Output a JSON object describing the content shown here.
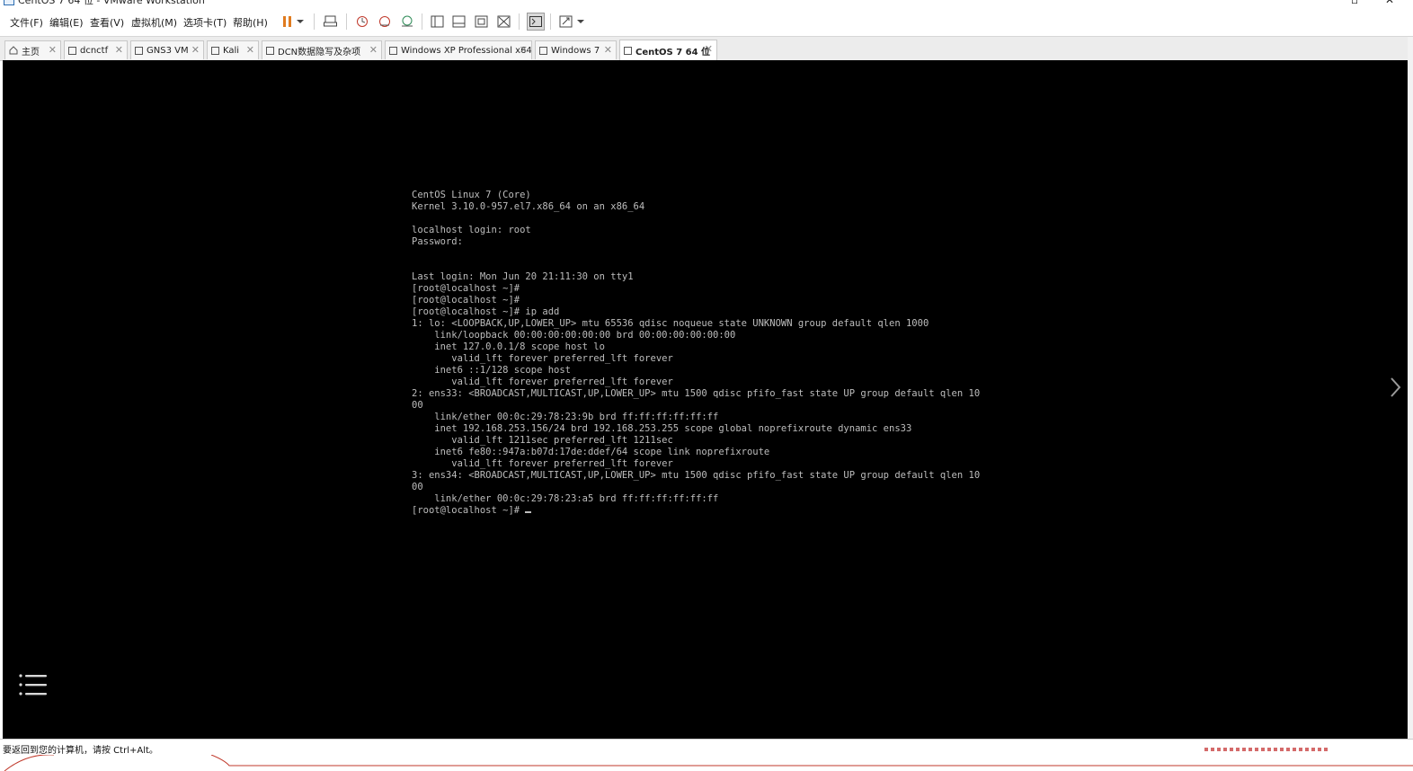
{
  "window": {
    "title": "CentOS 7 64 位 - VMware Workstation"
  },
  "menu": {
    "items": [
      "文件(F)",
      "编辑(E)",
      "查看(V)",
      "虚拟机(M)",
      "选项卡(T)",
      "帮助(H)"
    ]
  },
  "toolbar": {
    "icons": [
      "pause-icon",
      "dropdown-icon",
      "send-ctrl-alt-del-icon",
      "snapshot-icon",
      "revert-snapshot-icon",
      "snapshot-manager-icon",
      "show-library-icon",
      "thumbnail-bar-icon",
      "full-screen-icon",
      "unity-icon",
      "console-view-icon",
      "stretch-guest-icon"
    ]
  },
  "tabs": [
    {
      "label": "主页",
      "icon": "home-icon",
      "active": false
    },
    {
      "label": "dcnctf",
      "icon": "vm-icon",
      "active": false
    },
    {
      "label": "GNS3 VM",
      "icon": "vm-icon",
      "active": false
    },
    {
      "label": "Kali",
      "icon": "vm-icon",
      "active": false
    },
    {
      "label": "DCN数据隐写及杂项",
      "icon": "vm-icon",
      "active": false
    },
    {
      "label": "Windows XP Professional x64 ...",
      "icon": "vm-icon",
      "active": false
    },
    {
      "label": "Windows 7",
      "icon": "vm-icon",
      "active": false
    },
    {
      "label": "CentOS 7 64 位",
      "icon": "vm-icon",
      "active": true
    }
  ],
  "console": {
    "lines": [
      "CentOS Linux 7 (Core)",
      "Kernel 3.10.0-957.el7.x86_64 on an x86_64",
      "",
      "localhost login: root",
      "Password:",
      "",
      "",
      "Last login: Mon Jun 20 21:11:30 on tty1",
      "[root@localhost ~]#",
      "[root@localhost ~]#",
      "[root@localhost ~]# ip add",
      "1: lo: <LOOPBACK,UP,LOWER_UP> mtu 65536 qdisc noqueue state UNKNOWN group default qlen 1000",
      "    link/loopback 00:00:00:00:00:00 brd 00:00:00:00:00:00",
      "    inet 127.0.0.1/8 scope host lo",
      "       valid_lft forever preferred_lft forever",
      "    inet6 ::1/128 scope host",
      "       valid_lft forever preferred_lft forever",
      "2: ens33: <BROADCAST,MULTICAST,UP,LOWER_UP> mtu 1500 qdisc pfifo_fast state UP group default qlen 10",
      "00",
      "    link/ether 00:0c:29:78:23:9b brd ff:ff:ff:ff:ff:ff",
      "    inet 192.168.253.156/24 brd 192.168.253.255 scope global noprefixroute dynamic ens33",
      "       valid_lft 1211sec preferred_lft 1211sec",
      "    inet6 fe80::947a:b07d:17de:ddef/64 scope link noprefixroute",
      "       valid_lft forever preferred_lft forever",
      "3: ens34: <BROADCAST,MULTICAST,UP,LOWER_UP> mtu 1500 qdisc pfifo_fast state UP group default qlen 10",
      "00",
      "    link/ether 00:0c:29:78:23:a5 brd ff:ff:ff:ff:ff:ff"
    ],
    "prompt": "[root@localhost ~]# "
  },
  "status": {
    "text": "要返回到您的计算机，请按 Ctrl+Alt。"
  },
  "colors": {
    "screen": "#000000",
    "console_text": "#bdbdbd",
    "pause_accent": "#e07b1f"
  }
}
